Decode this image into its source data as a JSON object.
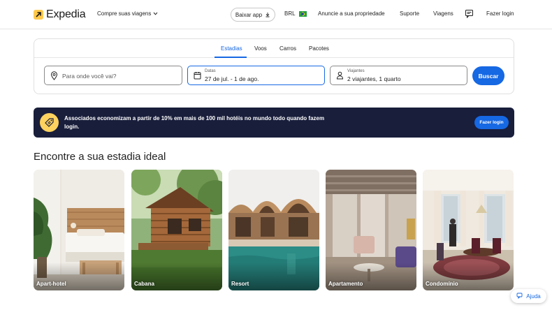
{
  "header": {
    "logo_text": "Expedia",
    "trip_menu": "Compre suas viagens",
    "app_button": "Baixar app",
    "currency": "BRL",
    "list_property": "Anuncie a sua propriedade",
    "support": "Suporte",
    "trips": "Viagens",
    "login": "Fazer login"
  },
  "search": {
    "tabs": [
      "Estadias",
      "Voos",
      "Carros",
      "Pacotes"
    ],
    "active_tab": "Estadias",
    "destination_placeholder": "Para onde você vai?",
    "dates_label": "Datas",
    "dates_value": "27 de jul. - 1 de ago.",
    "travelers_label": "Viajantes",
    "travelers_value": "2 viajantes, 1 quarto",
    "search_button": "Buscar"
  },
  "promo": {
    "text": "Associados economizam a partir de 10% em mais de 100 mil hotéis no mundo todo quando fazem login.",
    "button": "Fazer login"
  },
  "section": {
    "title": "Encontre a sua estadia ideal",
    "cards": [
      {
        "label": "Apart-hotel"
      },
      {
        "label": "Cabana"
      },
      {
        "label": "Resort"
      },
      {
        "label": "Apartamento"
      },
      {
        "label": "Condomínio"
      }
    ]
  },
  "help": {
    "label": "Ajuda"
  },
  "colors": {
    "brand_blue": "#1668e3",
    "promo_bg": "#191e3b",
    "logo_yellow": "#ffc94c"
  }
}
